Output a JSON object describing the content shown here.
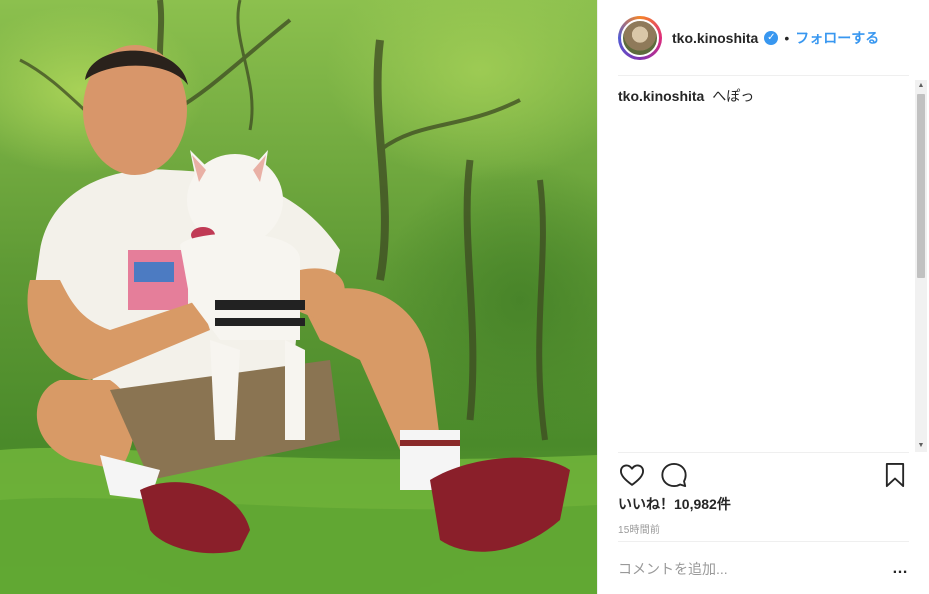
{
  "post": {
    "image_alt": "photo",
    "header": {
      "username": "tko.kinoshita",
      "verified_icon": "verified-badge-icon",
      "separator": "•",
      "follow_label": "フォローする"
    },
    "caption": {
      "username": "tko.kinoshita",
      "text": "へぽっ"
    },
    "actions": {
      "like_icon": "heart-icon",
      "comment_icon": "comment-icon",
      "save_icon": "bookmark-icon"
    },
    "likes_text": "いいね！10,982件",
    "time_text": "15時間前",
    "comment_placeholder": "コメントを追加...",
    "more_label": "…"
  },
  "colors": {
    "accent": "#3897f0",
    "text": "#262626",
    "muted": "#999999",
    "divider": "#efefef"
  }
}
